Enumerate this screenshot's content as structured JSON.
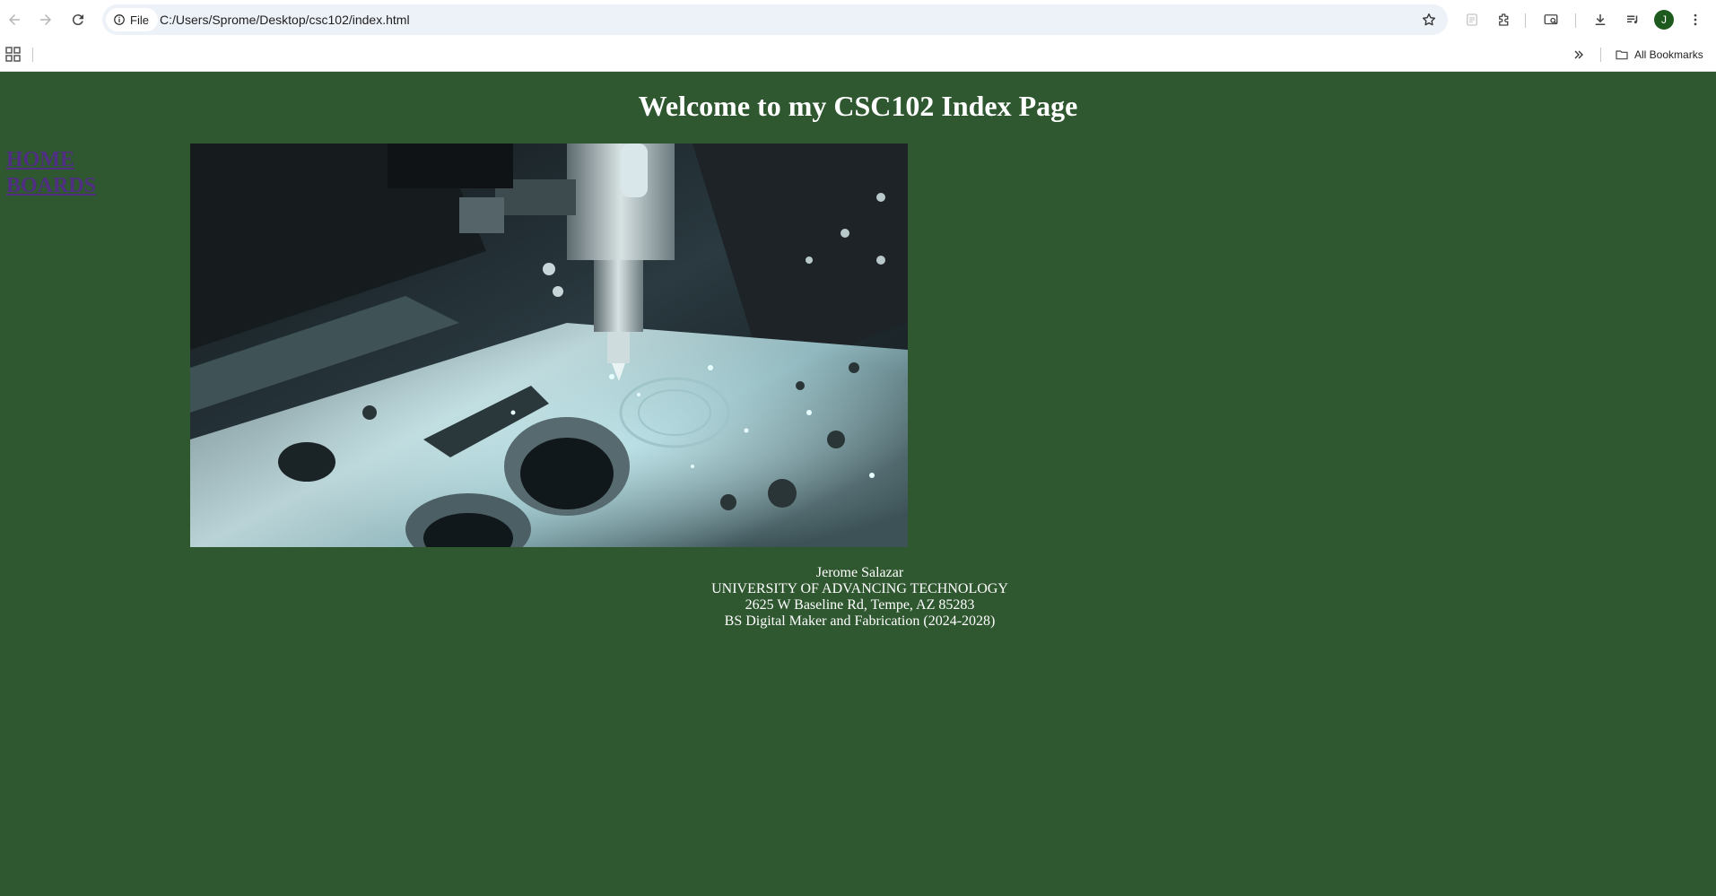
{
  "browser": {
    "file_chip_label": "File",
    "url": "C:/Users/Sprome/Desktop/csc102/index.html",
    "profile_initial": "J",
    "all_bookmarks_label": "All Bookmarks",
    "icons": [
      "back-arrow-icon",
      "forward-arrow-icon",
      "reload-icon",
      "info-icon",
      "star-icon",
      "reading-mode-icon",
      "extensions-icon",
      "media-cast-icon",
      "download-icon",
      "media-controls-icon",
      "more-menu-icon",
      "apps-icon",
      "chevron-double-right-icon",
      "folder-icon"
    ]
  },
  "page": {
    "background_color": "#2f5730",
    "heading": "Welcome to my CSC102 Index Page",
    "nav": [
      {
        "label": "HOME"
      },
      {
        "label": "BOARDS"
      }
    ],
    "link_color": "#4f2e84",
    "footer": {
      "name": "Jerome Salazar",
      "school": "UNIVERSITY OF ADVANCING TECHNOLOGY",
      "address": "2625 W Baseline Rd, Tempe, AZ 85283",
      "degree": "BS Digital Maker and Fabrication (2024-2028)"
    }
  }
}
